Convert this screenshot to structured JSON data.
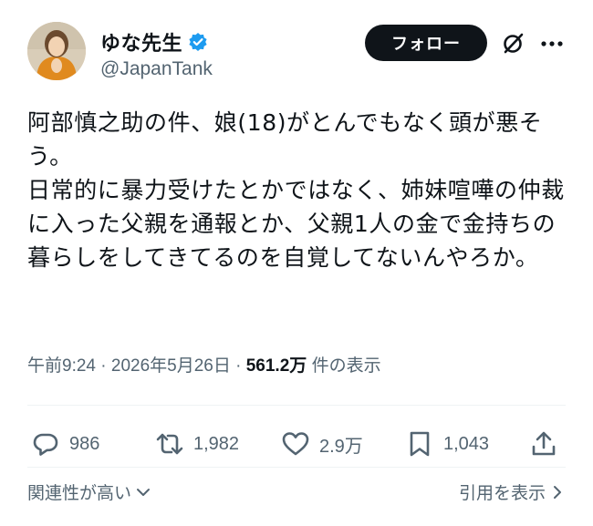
{
  "author": {
    "display_name": "ゆな先生",
    "handle": "@JapanTank",
    "verified": true
  },
  "header": {
    "follow_label": "フォロー",
    "grok_icon": "slashed-circle-icon",
    "more_icon": "more-dots-icon"
  },
  "tweet": {
    "text": "阿部慎之助の件、娘(18)がとんでもなく頭が悪そう。\n日常的に暴力受けたとかではなく、姉妹喧嘩の仲裁に入った父親を通報とか、父親1人の金で金持ちの暮らしをしてきてるのを自覚してないんやろか。",
    "time": "午前9:24",
    "date": "2026年5月26日",
    "separator": "·",
    "views_count": "561.2万",
    "views_label": "件の表示"
  },
  "actions": {
    "replies": "986",
    "reposts": "1,982",
    "likes": "2.9万",
    "bookmarks": "1,043"
  },
  "footer": {
    "relevance_label": "関連性が高い",
    "quotes_label": "引用を表示"
  },
  "colors": {
    "text": "#0f1419",
    "secondary": "#536471",
    "verified": "#1d9bf0",
    "button_bg": "#0f1419"
  }
}
